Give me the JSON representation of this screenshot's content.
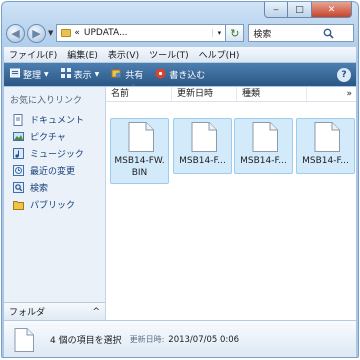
{
  "window": {
    "minimize": "‒",
    "maximize": "□",
    "close": "✕"
  },
  "address_bar": {
    "prefix": "«",
    "path": "UPDATA...",
    "dropdown": "▾"
  },
  "search": {
    "placeholder": "検索"
  },
  "menu": [
    "ファイル(F)",
    "編集(E)",
    "表示(V)",
    "ツール(T)",
    "ヘルプ(H)"
  ],
  "toolbar": {
    "organize": "整理",
    "views": "表示",
    "share": "共有",
    "burn": "書き込む",
    "help": "?"
  },
  "nav_pane": {
    "title": "お気に入りリンク",
    "items": [
      "ドキュメント",
      "ピクチャ",
      "ミュージック",
      "最近の変更",
      "検索",
      "パブリック"
    ],
    "folders_label": "フォルダ",
    "folders_toggle": "^"
  },
  "columns": {
    "name": "名前",
    "date": "更新日時",
    "type": "種類",
    "more": "»"
  },
  "files": [
    "MSB14-FW.\nBIN",
    "MSB14-F...",
    "MSB14-F...",
    "MSB14-F..."
  ],
  "details": {
    "count": "4 個の項目を選択",
    "modified_label": "更新日時:",
    "modified_value": "2013/07/05 0:06"
  },
  "colors": {
    "toolbar_top": "#4c7fb0",
    "toolbar_bottom": "#2b5685",
    "selection": "#d3eafb",
    "nav_link": "#17417a"
  }
}
